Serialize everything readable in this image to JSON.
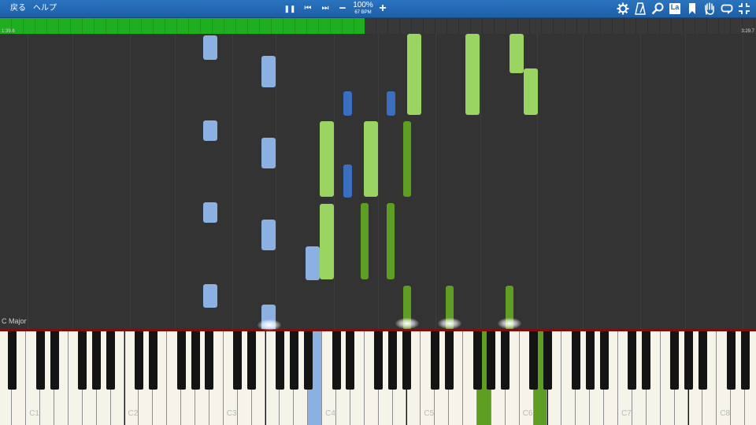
{
  "toolbar": {
    "back_label": "戻る",
    "help_label": "ヘルプ",
    "pause_symbol": "❚❚",
    "prev_symbol": "⏮",
    "next_symbol": "⏭",
    "zoom_out_symbol": "−",
    "zoom_in_symbol": "+",
    "zoom_percent": "100%",
    "tempo": "67 BPM",
    "badge_text": "La",
    "right_icons": [
      "settings-icon",
      "metronome-icon",
      "search-icon",
      "note-label-icon",
      "bookmark-icon",
      "hand-icon",
      "loop-icon",
      "fullscreen-icon"
    ]
  },
  "progress": {
    "current_time": "1:39.6",
    "total_time": "3:29.7",
    "fraction": 0.482
  },
  "key_signature": "C Major",
  "keyboard": {
    "first_octave": 1,
    "octave_labels": [
      "C1",
      "C2",
      "C3",
      "C4",
      "C5",
      "C6",
      "C7",
      "C8"
    ]
  },
  "colors": {
    "toolbar": "#1f66b2",
    "progress_fill": "#1fae1f",
    "note_light_blue": "#8bb1e3",
    "note_dark_blue": "#3a6fc0",
    "note_light_green": "#9ad562",
    "note_dark_green": "#5e9e22"
  }
}
